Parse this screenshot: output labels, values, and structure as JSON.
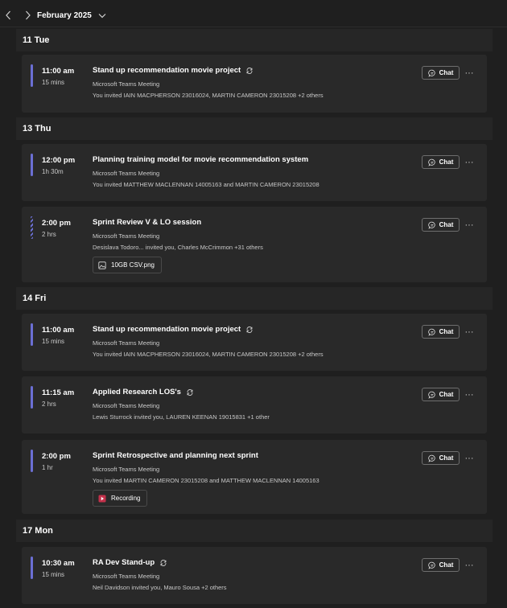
{
  "header": {
    "month": "February 2025"
  },
  "days": [
    {
      "label": "11 Tue",
      "events": [
        {
          "time": "11:00 am",
          "duration": "15 mins",
          "title": "Stand up recommendation movie project",
          "recurring": true,
          "type": "Microsoft Teams Meeting",
          "invite": "You invited IAIN MACPHERSON 23016024, MARTIN CAMERON 23015208 +2 others",
          "chat": "Chat"
        }
      ]
    },
    {
      "label": "13 Thu",
      "events": [
        {
          "time": "12:00 pm",
          "duration": "1h 30m",
          "title": "Planning training model for movie recommendation system",
          "recurring": false,
          "type": "Microsoft Teams Meeting",
          "invite": "You invited MATTHEW MACLENNAN 14005163 and MARTIN CAMERON 23015208",
          "chat": "Chat"
        },
        {
          "time": "2:00 pm",
          "duration": "2 hrs",
          "title": "Sprint Review V & LO session",
          "recurring": false,
          "tentative": true,
          "type": "Microsoft Teams Meeting",
          "invite": "Desislava Todoro... invited you, Charles McCrimmon +31 others",
          "chat": "Chat",
          "attachment": "10GB CSV.png"
        }
      ]
    },
    {
      "label": "14 Fri",
      "events": [
        {
          "time": "11:00 am",
          "duration": "15 mins",
          "title": "Stand up recommendation movie project",
          "recurring": true,
          "type": "Microsoft Teams Meeting",
          "invite": "You invited IAIN MACPHERSON 23016024, MARTIN CAMERON 23015208 +2 others",
          "chat": "Chat"
        },
        {
          "time": "11:15 am",
          "duration": "2 hrs",
          "title": "Applied Research LOS's",
          "recurring": true,
          "type": "Microsoft Teams Meeting",
          "invite": "Lewis Sturrock invited you, LAUREN KEENAN 19015831 +1 other",
          "chat": "Chat"
        },
        {
          "time": "2:00 pm",
          "duration": "1 hr",
          "title": "Sprint Retrospective and planning next sprint",
          "recurring": false,
          "type": "Microsoft Teams Meeting",
          "invite": "You invited MARTIN CAMERON 23015208 and MATTHEW MACLENNAN 14005163",
          "chat": "Chat",
          "recording": "Recording"
        }
      ]
    },
    {
      "label": "17 Mon",
      "events": [
        {
          "time": "10:30 am",
          "duration": "15 mins",
          "title": "RA Dev Stand-up",
          "recurring": true,
          "type": "Microsoft Teams Meeting",
          "invite": "Neil Davidson invited you, Mauro Sousa +2 others",
          "chat": "Chat"
        }
      ]
    }
  ],
  "icons": {
    "prev": "chevron-left-icon",
    "next": "chevron-right-icon",
    "month_dropdown": "chevron-down-icon",
    "recurring": "repeat-icon",
    "chat": "chat-bubble-icon",
    "more": "more-horizontal-icon",
    "image_file": "image-file-icon",
    "recording": "play-recording-icon"
  },
  "colors": {
    "background": "#1f1f1f",
    "card": "#292929",
    "day_header": "#262626",
    "accent": "#6b6fd4",
    "recording_red": "#c4314b"
  }
}
